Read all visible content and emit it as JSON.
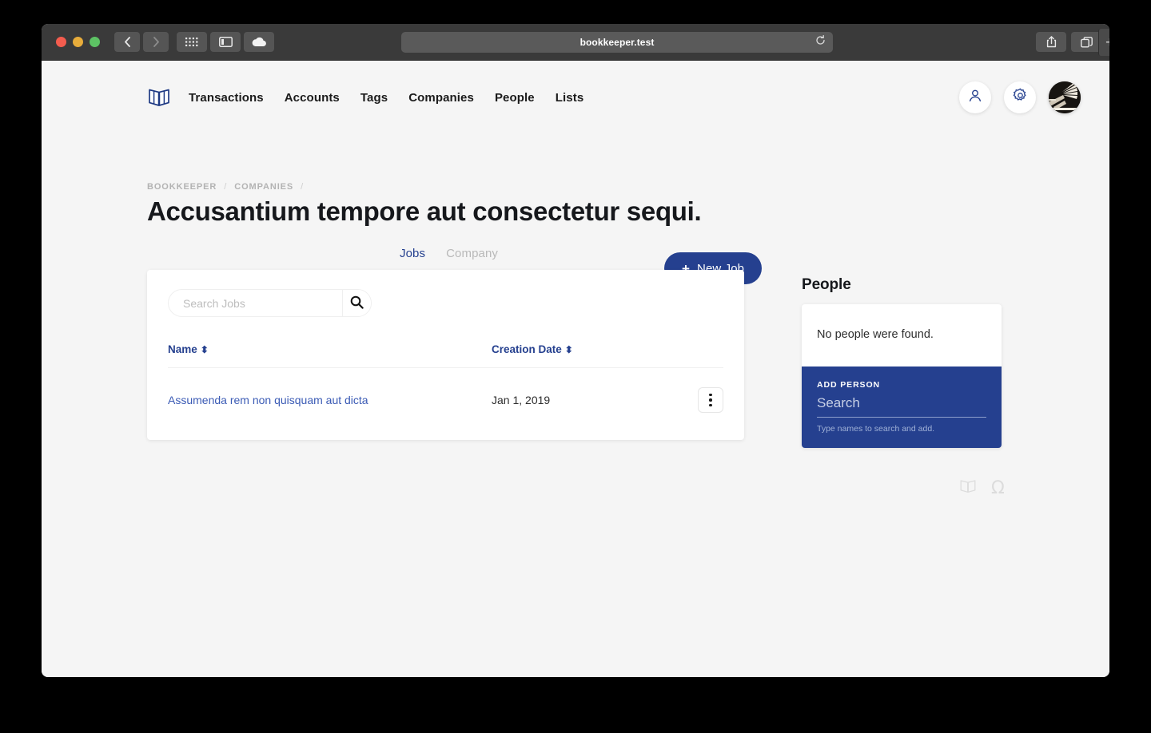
{
  "browser": {
    "url": "bookkeeper.test",
    "icons": {
      "back": "back-chevron-icon",
      "forward": "forward-chevron-icon",
      "grid": "grid-icon",
      "sidebar": "sidebar-icon",
      "cloud": "cloud-icon",
      "reload": "reload-icon",
      "share": "share-icon",
      "tabs": "tabs-icon",
      "newtab": "+"
    }
  },
  "nav": {
    "logo": "book-logo-icon",
    "links": [
      {
        "label": "Transactions"
      },
      {
        "label": "Accounts"
      },
      {
        "label": "Tags"
      },
      {
        "label": "Companies"
      },
      {
        "label": "People"
      },
      {
        "label": "Lists"
      }
    ],
    "actions": {
      "person": "person-icon",
      "settings": "gear-icon",
      "avatar": "user-avatar"
    }
  },
  "breadcrumb": {
    "items": [
      "BOOKKEEPER",
      "COMPANIES"
    ],
    "separator": "/"
  },
  "page": {
    "title": "Accusantium tempore aut consectetur sequi."
  },
  "tabs": {
    "items": [
      {
        "label": "Jobs",
        "active": true
      },
      {
        "label": "Company",
        "active": false
      }
    ]
  },
  "actions": {
    "new_job": "New Job",
    "new_job_plus": "+"
  },
  "jobs_panel": {
    "search": {
      "placeholder": "Search Jobs",
      "value": "",
      "button_icon": "search-icon"
    },
    "table": {
      "columns": [
        {
          "label": "Name",
          "sortable": true
        },
        {
          "label": "Creation Date",
          "sortable": true
        }
      ],
      "sort_glyph": "⬍",
      "rows": [
        {
          "name": "Assumenda rem non quisquam aut dicta",
          "creation_date": "Jan 1, 2019"
        }
      ]
    }
  },
  "people_panel": {
    "heading": "People",
    "empty_message": "No people were found.",
    "add_person": {
      "label": "ADD PERSON",
      "placeholder": "Search",
      "value": "",
      "hint": "Type names to search and add."
    }
  },
  "footer": {
    "icons": [
      "book-logo-icon",
      "omega-icon"
    ],
    "omega_glyph": "Ω"
  },
  "colors": {
    "navy": "#25408f",
    "page_bg": "#f5f5f5",
    "card_bg": "#ffffff",
    "title": "#16181c",
    "muted": "#b3b3b3",
    "link": "#3b5bb5"
  }
}
